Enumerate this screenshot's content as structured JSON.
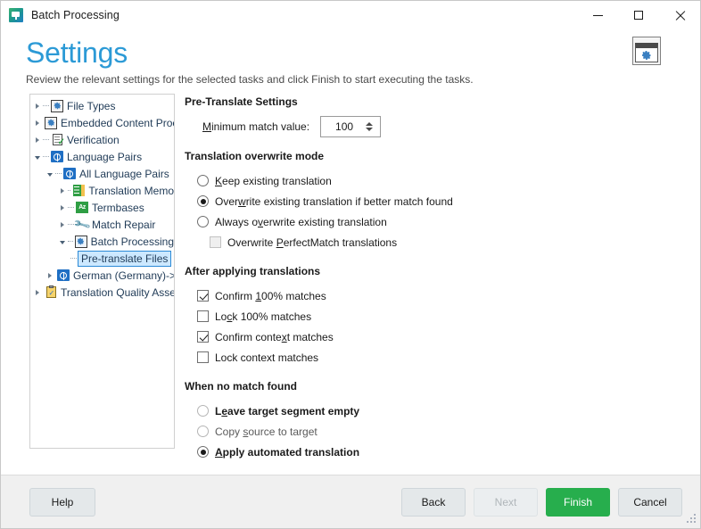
{
  "window": {
    "title": "Batch Processing",
    "app_icon": "batch-processing-icon",
    "minimize_label": "Minimize",
    "maximize_label": "Maximize",
    "close_label": "Close"
  },
  "header": {
    "title": "Settings",
    "subtitle": "Review the relevant settings for the selected tasks and click Finish to start executing the tasks.",
    "title_color": "#2c9ad6",
    "gear_button_icon": "window-gear-icon"
  },
  "tree": {
    "items": [
      {
        "label": "File Types",
        "icon": "gear-dark-icon",
        "indent": 0,
        "expander": "collapsed",
        "selected": false
      },
      {
        "label": "Embedded Content Proc",
        "icon": "gear-dark-icon",
        "indent": 0,
        "expander": "collapsed",
        "selected": false
      },
      {
        "label": "Verification",
        "icon": "verification-doc-icon",
        "indent": 0,
        "expander": "collapsed",
        "selected": false
      },
      {
        "label": "Language Pairs",
        "icon": "globe-icon",
        "indent": 0,
        "expander": "expanded",
        "selected": false
      },
      {
        "label": "All Language Pairs",
        "icon": "globe-icon",
        "indent": 1,
        "expander": "expanded",
        "selected": false
      },
      {
        "label": "Translation Memo",
        "icon": "translation-memory-icon",
        "indent": 2,
        "expander": "collapsed",
        "selected": false
      },
      {
        "label": "Termbases",
        "icon": "termbase-icon",
        "indent": 2,
        "expander": "collapsed",
        "selected": false
      },
      {
        "label": "Match Repair",
        "icon": "wrench-icon",
        "indent": 2,
        "expander": "collapsed",
        "selected": false
      },
      {
        "label": "Batch Processing",
        "icon": "gear-blue-icon",
        "indent": 2,
        "expander": "expanded",
        "selected": false
      },
      {
        "label": "Pre-translate Files",
        "icon": "none",
        "indent": 3,
        "expander": "none",
        "selected": true
      },
      {
        "label": "German (Germany)->",
        "icon": "globe-icon",
        "indent": 1,
        "expander": "collapsed",
        "selected": false
      },
      {
        "label": "Translation Quality Assess",
        "icon": "quality-clipboard-icon",
        "indent": 0,
        "expander": "collapsed",
        "selected": false
      }
    ],
    "selection_bg": "#cce8ff",
    "selection_border": "#2c8ad6"
  },
  "settings": {
    "pre_translate": {
      "title": "Pre-Translate Settings",
      "min_match_label_pre": "M",
      "min_match_label_post": "inimum match value:",
      "min_match_value": "100"
    },
    "overwrite_mode": {
      "title": "Translation overwrite mode",
      "options": [
        {
          "pre": "K",
          "mnemonic": "",
          "post": "eep existing translation",
          "checked": false,
          "bold": false,
          "dim": false
        },
        {
          "pre": "Over",
          "mnemonic": "w",
          "post": "rite existing translation if better match found",
          "checked": true,
          "bold": false,
          "dim": false
        },
        {
          "pre": "Always o",
          "mnemonic": "v",
          "post": "erwrite existing translation",
          "checked": false,
          "bold": false,
          "dim": false
        }
      ],
      "sub_checkbox": {
        "pre": "Overwrite ",
        "mnemonic": "P",
        "post": "erfectMatch translations",
        "checked": false,
        "disabled": true
      }
    },
    "after_applying": {
      "title": "After applying translations",
      "options": [
        {
          "pre": "Confirm ",
          "mnemonic": "1",
          "post": "00% matches",
          "checked": true
        },
        {
          "pre": "Lo",
          "mnemonic": "c",
          "post": "k 100% matches",
          "checked": false
        },
        {
          "pre": "Confirm conte",
          "mnemonic": "x",
          "post": "t matches",
          "checked": true
        },
        {
          "pre": "Lock context matches",
          "mnemonic": "",
          "post": "",
          "checked": false
        }
      ]
    },
    "no_match": {
      "title": "When no match found",
      "options": [
        {
          "pre": "L",
          "mnemonic": "e",
          "post": "ave target segment empty",
          "checked": false,
          "bold": true,
          "dim": false
        },
        {
          "pre": "Copy ",
          "mnemonic": "s",
          "post": "ource to target",
          "checked": false,
          "bold": false,
          "dim": true
        },
        {
          "pre": "",
          "mnemonic": "A",
          "post": "pply automated translation",
          "checked": true,
          "bold": true,
          "dim": false
        }
      ]
    }
  },
  "footer": {
    "help_label": "Help",
    "back_label": "Back",
    "next_label": "Next",
    "next_disabled": true,
    "finish_label": "Finish",
    "finish_color": "#27ae4d",
    "cancel_label": "Cancel"
  }
}
